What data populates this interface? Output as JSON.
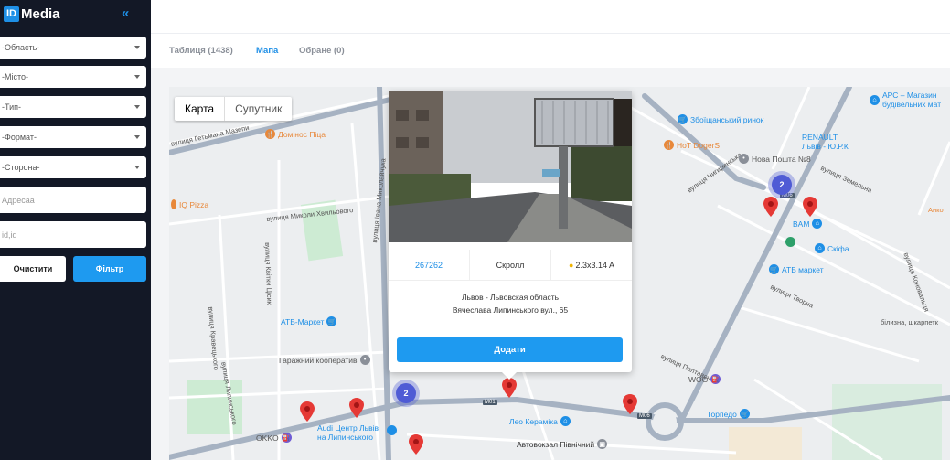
{
  "sidebar": {
    "logo_mark": "ID",
    "logo_text": "Media",
    "collapse_glyph": "«",
    "filters": [
      {
        "label": "-Область-"
      },
      {
        "label": "-Місто-"
      },
      {
        "label": "-Тип-"
      },
      {
        "label": "-Формат-"
      },
      {
        "label": "-Сторона-"
      }
    ],
    "address_placeholder": "Адресаа",
    "id_placeholder": "id,id",
    "clear_label": "Очистити",
    "filter_label": "Фільтр"
  },
  "tabs": [
    {
      "label": "Таблиця (1438)"
    },
    {
      "label": "Мапа"
    },
    {
      "label": "Обране (0)"
    }
  ],
  "map": {
    "type_map": "Карта",
    "type_satellite": "Супутник",
    "clusters": [
      {
        "count": "2"
      },
      {
        "count": "2"
      }
    ],
    "pois": [
      {
        "label": "Домінос Піца"
      },
      {
        "label": "IQ Pizza"
      },
      {
        "label": "АТБ-Маркет"
      },
      {
        "label": "Гаражний кооператив"
      },
      {
        "label": "Audi Центр Львів"
      },
      {
        "label": "на Липинського"
      },
      {
        "label": "Лео Кераміка"
      },
      {
        "label": "Автовокзал Північний"
      },
      {
        "label": "Торпедо"
      },
      {
        "label": "WOG"
      },
      {
        "label": "Збоїщанський ринок"
      },
      {
        "label": "HoT DogerS"
      },
      {
        "label": "Нова Пошта №8"
      },
      {
        "label": "RENAULT"
      },
      {
        "label": "Львів - Ю.Р.К"
      },
      {
        "label": "BAM"
      },
      {
        "label": "Скіфа"
      },
      {
        "label": "АТБ маркет"
      },
      {
        "label": "АРС – Магазин"
      },
      {
        "label": "будівельних мат"
      },
      {
        "label": "OKKO"
      }
    ],
    "streets": [
      {
        "label": "вулиця Гетьмана Мазепи"
      },
      {
        "label": "вулиця Миколи Хвильового"
      },
      {
        "label": "вулиця Івана Миколайчука"
      },
      {
        "label": "вулиця Кравецького"
      },
      {
        "label": "вулиця Квітки Цісик"
      },
      {
        "label": "вулиця Липинського"
      },
      {
        "label": "вулиця Чигиринська"
      },
      {
        "label": "вулиця Земельна"
      },
      {
        "label": "вулиця Творча"
      },
      {
        "label": "вулиця Полтавська"
      },
      {
        "label": "вулиця Коновальця"
      },
      {
        "label": "білизна, шкарпетк"
      },
      {
        "label": "Анко"
      }
    ],
    "road_badges": [
      "M06",
      "M01",
      "M06"
    ]
  },
  "popup": {
    "id": "267262",
    "type": "Скролл",
    "size": "2.3x3.14 A",
    "address_line1": "Львов - Львовская область",
    "address_line2": "Вячеслава Липинського вул., 65",
    "add_label": "Додати"
  }
}
